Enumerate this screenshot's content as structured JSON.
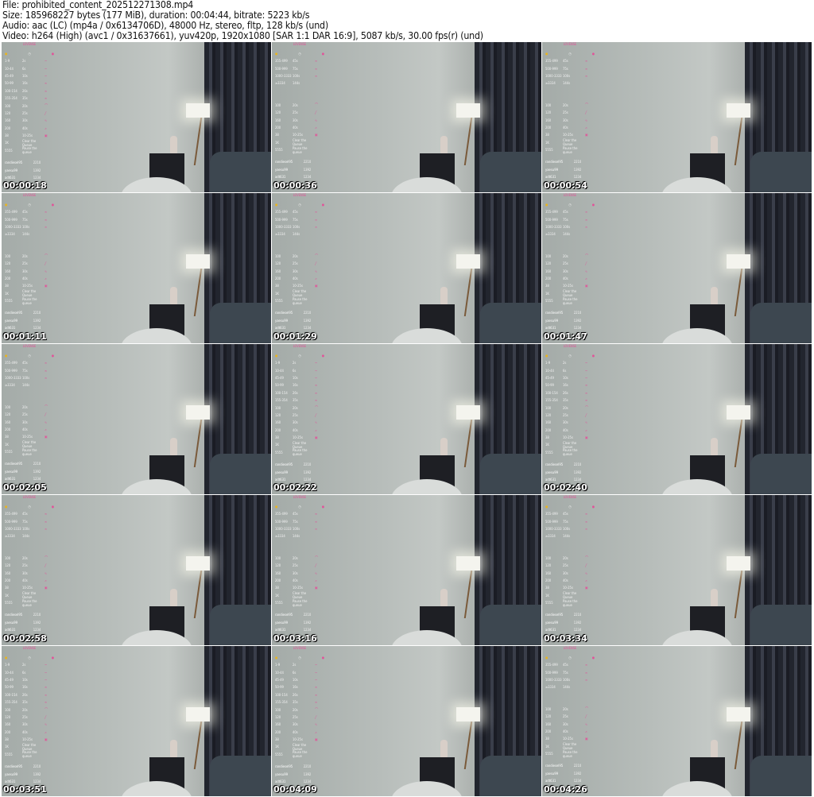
{
  "header": {
    "lines": [
      "File: prohibited_content_202512271308.mp4",
      "Size: 185968227 bytes (177 MiB), duration: 00:04:44, bitrate: 5223 kb/s",
      "Audio: aac (LC) (mp4a / 0x6134706D), 48000 Hz, stereo, fltp, 128 kb/s (und)",
      "Video: h264 (High) (avc1 / 0x31637661), yuv420p, 1920x1080 [SAR 1:1 DAR 16:9], 5087 kb/s, 30.00 fps(r) (und)"
    ]
  },
  "overlay": {
    "logo": "LOVENSE",
    "list_a": [
      [
        "1-9",
        "2s",
        "~"
      ],
      [
        "10-44",
        "6s",
        "~"
      ],
      [
        "45-49",
        "10s",
        "~"
      ],
      [
        "50-99",
        "16s",
        "≈"
      ],
      [
        "100-154",
        "26s",
        "≈"
      ],
      [
        "155-354",
        "35s",
        "≈"
      ]
    ],
    "list_b": [
      [
        "355-499",
        "45s",
        "≈"
      ],
      [
        "500-999",
        "75s",
        "≈"
      ],
      [
        "1000-3333",
        "100s",
        "≈"
      ],
      [
        "≥3334",
        "144s",
        ""
      ]
    ],
    "specials": [
      [
        "100",
        "20s",
        "⌒"
      ],
      [
        "120",
        "25s",
        "╱"
      ],
      [
        "160",
        "30s",
        "∿"
      ],
      [
        "200",
        "40s",
        "⩘"
      ],
      [
        "38",
        "10-25s",
        "▣"
      ],
      [
        "1K",
        "Clear the Queue",
        ""
      ],
      [
        "5555",
        "Pause the queue",
        ""
      ]
    ],
    "leaderboard": [
      [
        "randiesel95",
        "2210"
      ],
      [
        "yaesu99",
        "1392"
      ],
      [
        "adt631",
        "1234"
      ]
    ]
  },
  "frames": [
    {
      "time": "00:00:18",
      "list": "a"
    },
    {
      "time": "00:00:36",
      "list": "b"
    },
    {
      "time": "00:00:54",
      "list": "b"
    },
    {
      "time": "00:01:11",
      "list": "b"
    },
    {
      "time": "00:01:29",
      "list": "b"
    },
    {
      "time": "00:01:47",
      "list": "b"
    },
    {
      "time": "00:02:05",
      "list": "b"
    },
    {
      "time": "00:02:22",
      "list": "a"
    },
    {
      "time": "00:02:40",
      "list": "a"
    },
    {
      "time": "00:02:58",
      "list": "b"
    },
    {
      "time": "00:03:16",
      "list": "b"
    },
    {
      "time": "00:03:34",
      "list": "b"
    },
    {
      "time": "00:03:51",
      "list": "a"
    },
    {
      "time": "00:04:09",
      "list": "a"
    },
    {
      "time": "00:04:26",
      "list": "b"
    }
  ]
}
